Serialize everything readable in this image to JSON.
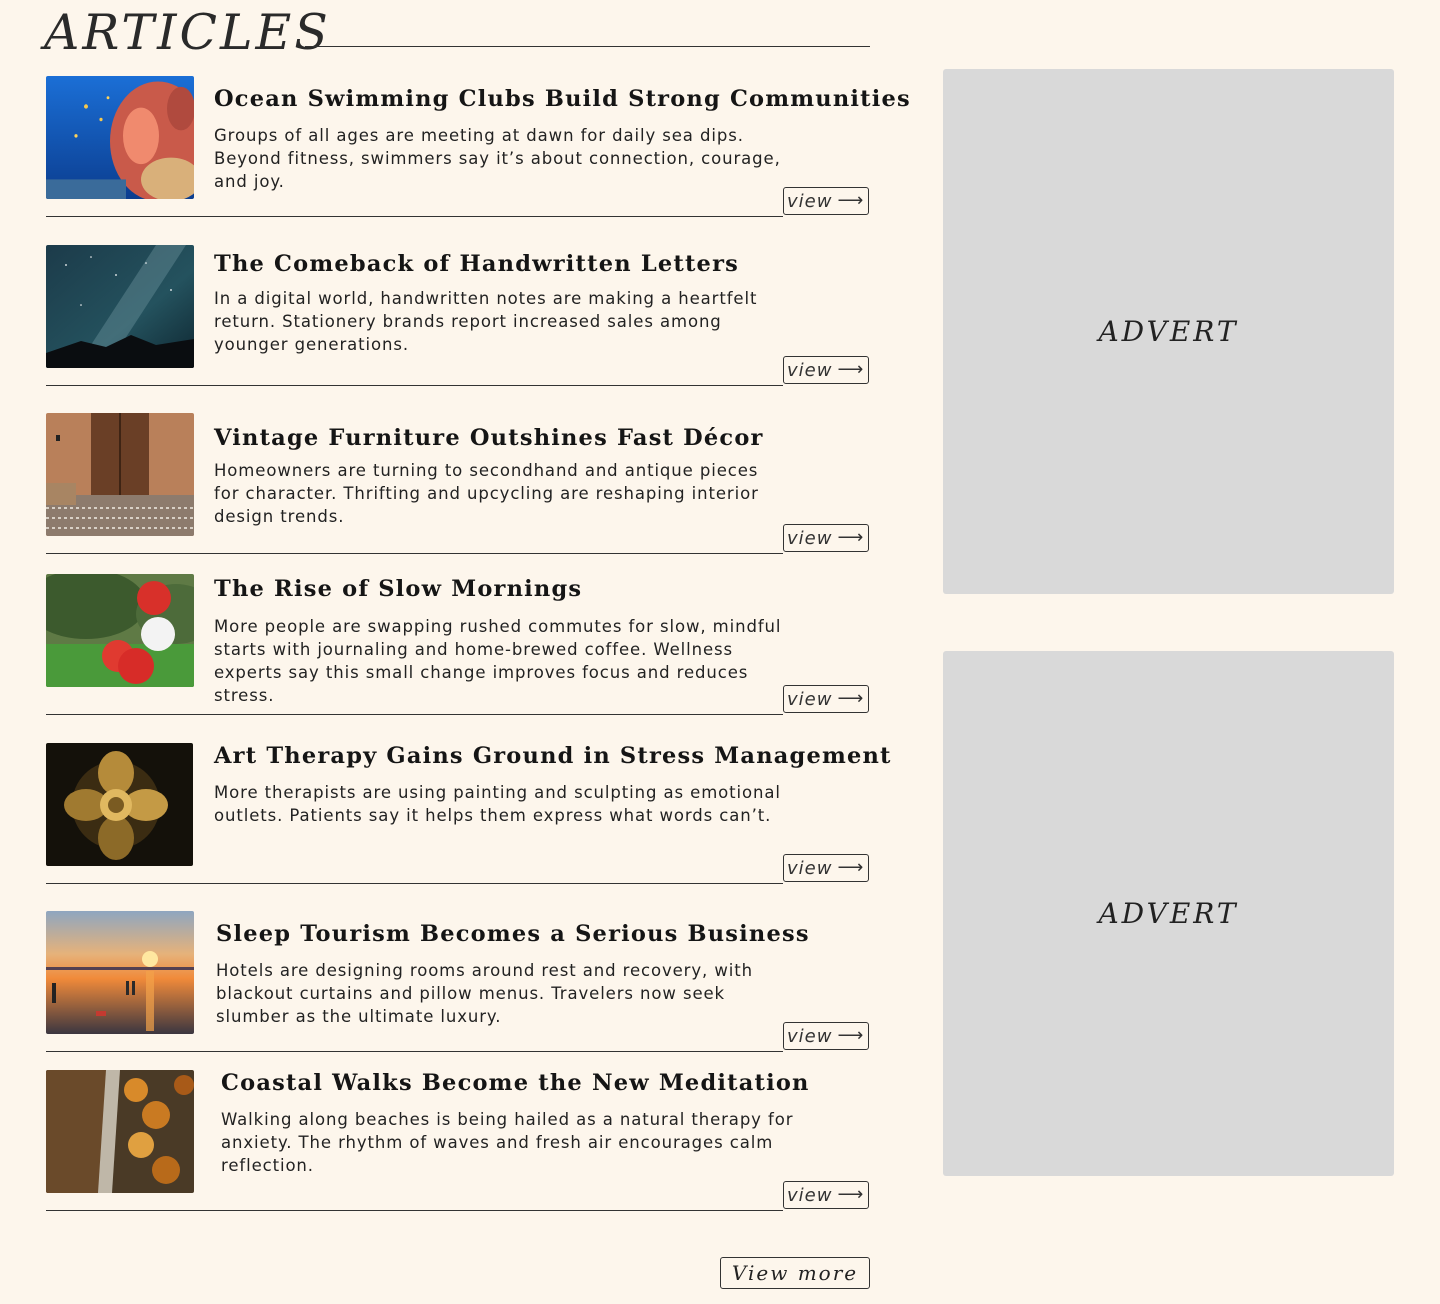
{
  "section": {
    "title": "ARTICLES"
  },
  "articles": [
    {
      "title": "Ocean Swimming Clubs Build Strong Communities",
      "body": "Groups of all ages are meeting at dawn for daily sea dips. Beyond fitness, swimmers say it’s about connection, courage, and joy.",
      "view_label": "view",
      "image": "coral-reef"
    },
    {
      "title": "The Comeback of Handwritten Letters",
      "body": "In a digital world, handwritten notes are making a heartfelt return. Stationery brands report increased sales among younger generations.",
      "view_label": "view",
      "image": "night-sky"
    },
    {
      "title": "Vintage Furniture Outshines Fast Décor",
      "body": "Homeowners are turning to secondhand and antique pieces for character. Thrifting and upcycling are reshaping interior design trends.",
      "view_label": "view",
      "image": "wooden-door"
    },
    {
      "title": "The Rise of Slow Mornings",
      "body": "More people are swapping rushed commutes for slow, mindful starts with journaling and home-brewed coffee. Wellness experts say this small change improves focus and reduces stress.",
      "view_label": "view",
      "image": "balloons"
    },
    {
      "title": "Art Therapy Gains Ground in Stress Management",
      "body": "More therapists are using painting and sculpting as emotional outlets. Patients say it helps them express what words can’t.",
      "view_label": "view",
      "image": "gold-flower"
    },
    {
      "title": "Sleep Tourism Becomes a Serious Business",
      "body": "Hotels are designing rooms around rest and recovery, with blackout curtains and pillow menus. Travelers now seek slumber as the ultimate luxury.",
      "view_label": "view",
      "image": "sunset-beach"
    },
    {
      "title": "Coastal Walks Become the New Meditation",
      "body": "Walking along beaches is being hailed as a natural therapy for anxiety. The rhythm of waves and fresh air encourages calm reflection.",
      "view_label": "view",
      "image": "autumn-path"
    }
  ],
  "adverts": [
    {
      "label": "ADVERT"
    },
    {
      "label": "ADVERT"
    }
  ],
  "view_more_label": "View more",
  "arrow_glyph": "⟶"
}
